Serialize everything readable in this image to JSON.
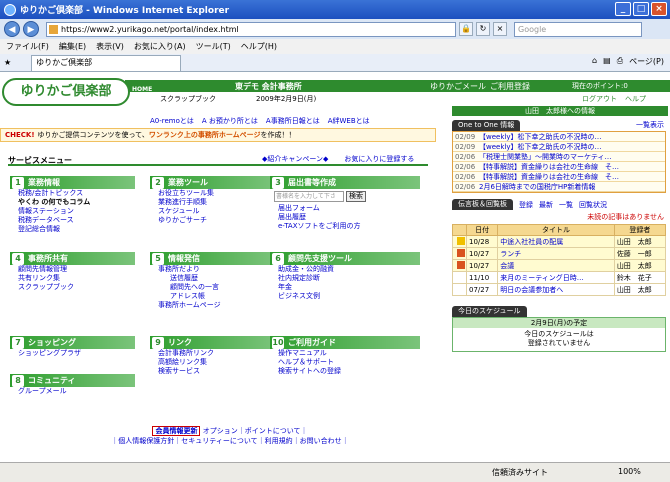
{
  "browser": {
    "title": "ゆりかご倶楽部 - Windows Internet Explorer",
    "url": "https://www2.yurikago.net/portal/index.html",
    "search_placeholder": "Google",
    "menu": [
      "ファイル(F)",
      "編集(E)",
      "表示(V)",
      "お気に入り(A)",
      "ツール(T)",
      "ヘルプ(H)"
    ],
    "tab_label": "ゆりかご倶楽部",
    "tools": [
      "ページ(P)"
    ],
    "status_trust": "信頼済みサイト",
    "zoom": "100%"
  },
  "header": {
    "logo": "ゆりかご倶楽部",
    "home": "HOME",
    "title": "東デモ 会計事務所",
    "mail_link": "ゆりかごメール",
    "signup_link": "ご利用登録",
    "points": "現在のポイント:0",
    "scrapbook": "スクラップブック",
    "date": "2009年2月9日(月)",
    "logout": "ログアウト",
    "help": "ヘルプ"
  },
  "top_links": [
    "A0-remoとは",
    "A お預かり所とは",
    "A事務所日報とは",
    "A絆WEBとは"
  ],
  "notice": {
    "check": "CHECK!",
    "text_a": "ゆりかご提供コンテンツを使って、",
    "text_hl": "ワンランク上の",
    "text_b": "事務所ホームページ",
    "text_c": "を作成！！"
  },
  "service": {
    "title": "サービスメニュー",
    "campaign": "◆紹介キャンペーン◆",
    "favorite": "お気に入りに登録する"
  },
  "categories": {
    "c1": {
      "num": "1",
      "title": "業務情報",
      "items": [
        "税務/会計トピックス",
        "やくわ の何でもコラム",
        "情報ステーション",
        "税務データベース",
        "登記総合情報"
      ]
    },
    "c2": {
      "num": "2",
      "title": "業務ツール",
      "items": [
        "お役立ちツール集",
        "業務進行手順集",
        "スケジュール",
        "ゆりかごサーチ"
      ]
    },
    "c3": {
      "num": "3",
      "title": "届出書等作成",
      "search_placeholder": "書様名を入力して下さ",
      "search_btn": "検索",
      "items": [
        "届出フォーム",
        "届出履歴",
        "e-TAXソフトをご利用の方"
      ]
    },
    "c4": {
      "num": "4",
      "title": "事務所共有",
      "items": [
        "顧問先情報管理",
        "共有リンク集",
        "スクラップブック"
      ]
    },
    "c5": {
      "num": "5",
      "title": "情報発信",
      "items": [
        "事務所だより",
        "送信履歴",
        "顧問先への一言",
        "アドレス帳",
        "事務所ホームページ"
      ]
    },
    "c6": {
      "num": "6",
      "title": "顧問先支援ツール",
      "items": [
        "助成金・公的融資",
        "社内規定診断",
        "年金",
        "ビジネス文例"
      ]
    },
    "c7": {
      "num": "7",
      "title": "ショッピング",
      "items": [
        "ショッピングプラザ"
      ]
    },
    "c8": {
      "num": "8",
      "title": "コミュニティ",
      "items": [
        "グループメール"
      ]
    },
    "c9": {
      "num": "9",
      "title": "リンク",
      "items": [
        "会計事務所リンク",
        "高額絵リンク集",
        "検索サービス"
      ]
    },
    "c10": {
      "num": "10",
      "title": "ご利用ガイド",
      "items": [
        "操作マニュアル",
        "ヘルプ＆サポート",
        "検索サイトへの登録"
      ]
    }
  },
  "footer": {
    "member": "会員情報更新",
    "line1": "オプション｜ポイントについて｜",
    "line2": "｜個人情報保護方針｜セキュリティーについて｜利用規約｜お問い合わせ｜"
  },
  "right": {
    "green": "山田　太郎様への情報",
    "info_tab": "One to One 情報",
    "list_all": "一覧表示",
    "info": [
      {
        "date": "02/09",
        "title": "【weekly】松下幸之助氏の不況時の…"
      },
      {
        "date": "02/09",
        "title": "【weekly】松下幸之助氏の不況時の…"
      },
      {
        "date": "02/06",
        "title": "「税理士関業塾」〜開業時のマーケティ…"
      },
      {
        "date": "02/06",
        "title": "【特事解説】資金繰りは会社の生命線　そ…"
      },
      {
        "date": "02/06",
        "title": "【特事解説】資金繰りは会社の生命線　そ…"
      },
      {
        "date": "02/06",
        "title": "2月6日解時までの国税庁HP新着情報"
      }
    ],
    "bb_tab": "伝言板＆回覧板",
    "bb_links": [
      "登録",
      "最新",
      "一覧",
      "回覧状況"
    ],
    "unread": "未読の記事はありません",
    "bb_headers": [
      "日付",
      "タイトル",
      "登録者"
    ],
    "bb_rows": [
      {
        "icon": "warn",
        "date": "10/28",
        "title": "中途入社社員の配属",
        "by": "山田　太郎"
      },
      {
        "icon": "red",
        "date": "10/27",
        "title": "ランチ",
        "by": "佐藤　一郎"
      },
      {
        "icon": "red",
        "date": "10/27",
        "title": "会議",
        "by": "山田　太郎"
      },
      {
        "icon": "",
        "date": "11/10",
        "title": "来月のミーティング日時…",
        "by": "鈴木　花子"
      },
      {
        "icon": "",
        "date": "07/27",
        "title": "明日の会議参加者へ",
        "by": "山田　太郎"
      }
    ],
    "sched_tab": "今日のスケジュール",
    "sched_date": "2月9日(月)の予定",
    "sched_msg1": "今日のスケジュールは",
    "sched_msg2": "登録されていません"
  }
}
